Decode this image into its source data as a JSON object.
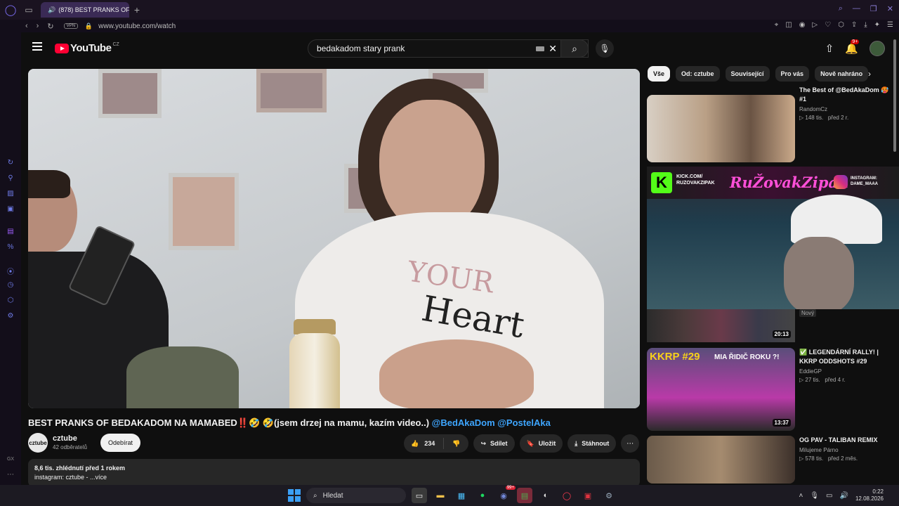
{
  "browser": {
    "tab_title": "(878) BEST PRANKS OF",
    "new_tab": "+",
    "vpn": "VPN",
    "url": "www.youtube.com/watch"
  },
  "youtube": {
    "logo_text": "YouTube",
    "country": "CZ",
    "search_value": "bedakadom stary prank",
    "notifications": "9+"
  },
  "video": {
    "title_main": "BEST PRANKS OF BEDAKADOM NA MAMABED‼️🤣 🤣(jsem drzej na mamu, kazím video..)",
    "title_tags": "@BedAkaDom @PostelAka",
    "shirt_text_1": "YOUR",
    "shirt_text_2": "Heart",
    "channel_avatar": "cztube",
    "channel_name": "cztube",
    "subscribers": "42 odběratelů",
    "subscribe_label": "Odebírat",
    "likes": "234",
    "share_label": "Sdílet",
    "save_label": "Uložit",
    "download_label": "Stáhnout",
    "views_time": "8,6 tis. zhlédnutí  před 1 rokem",
    "description": "instagram: cztube - ...více"
  },
  "chips": [
    "Vše",
    "Od: cztube",
    "Související",
    "Pro vás",
    "Nově nahráno"
  ],
  "recommendations": [
    {
      "title": "The Best of @BedAkaDom 🥵 #1",
      "channel": "RandomCz",
      "views": "148 tis.",
      "age": "před 2 r."
    },
    {
      "badge": "Nový",
      "duration": "20:13"
    },
    {
      "title": "✅ LEGENDÁRNÍ RALLY! | KKRP ODDSHOTS #29",
      "channel": "EddieGP",
      "views": "27 tis.",
      "age": "před 4 r.",
      "duration": "13:37",
      "thumb_text": "KKRP #29",
      "thumb_sub": "MIA ŘIDIČ ROKU ?!"
    },
    {
      "title": "OG PAV - TALIBAN REMIX",
      "channel": "Milujeme Párno",
      "views": "578 tis.",
      "age": "před 2 měs."
    }
  ],
  "overlay": {
    "kick_url": "KICK.COM/",
    "kick_user": "RUZOVAKZIPAK",
    "brand": "RuŽovakZipak",
    "ig_label": "INSTAGRAM:",
    "ig_user": "DAME_MAAA"
  },
  "taskbar": {
    "search_placeholder": "Hledat",
    "time": "0:22",
    "date": "12.08.2026",
    "badge": "99+"
  },
  "sidebar_label": "GX"
}
